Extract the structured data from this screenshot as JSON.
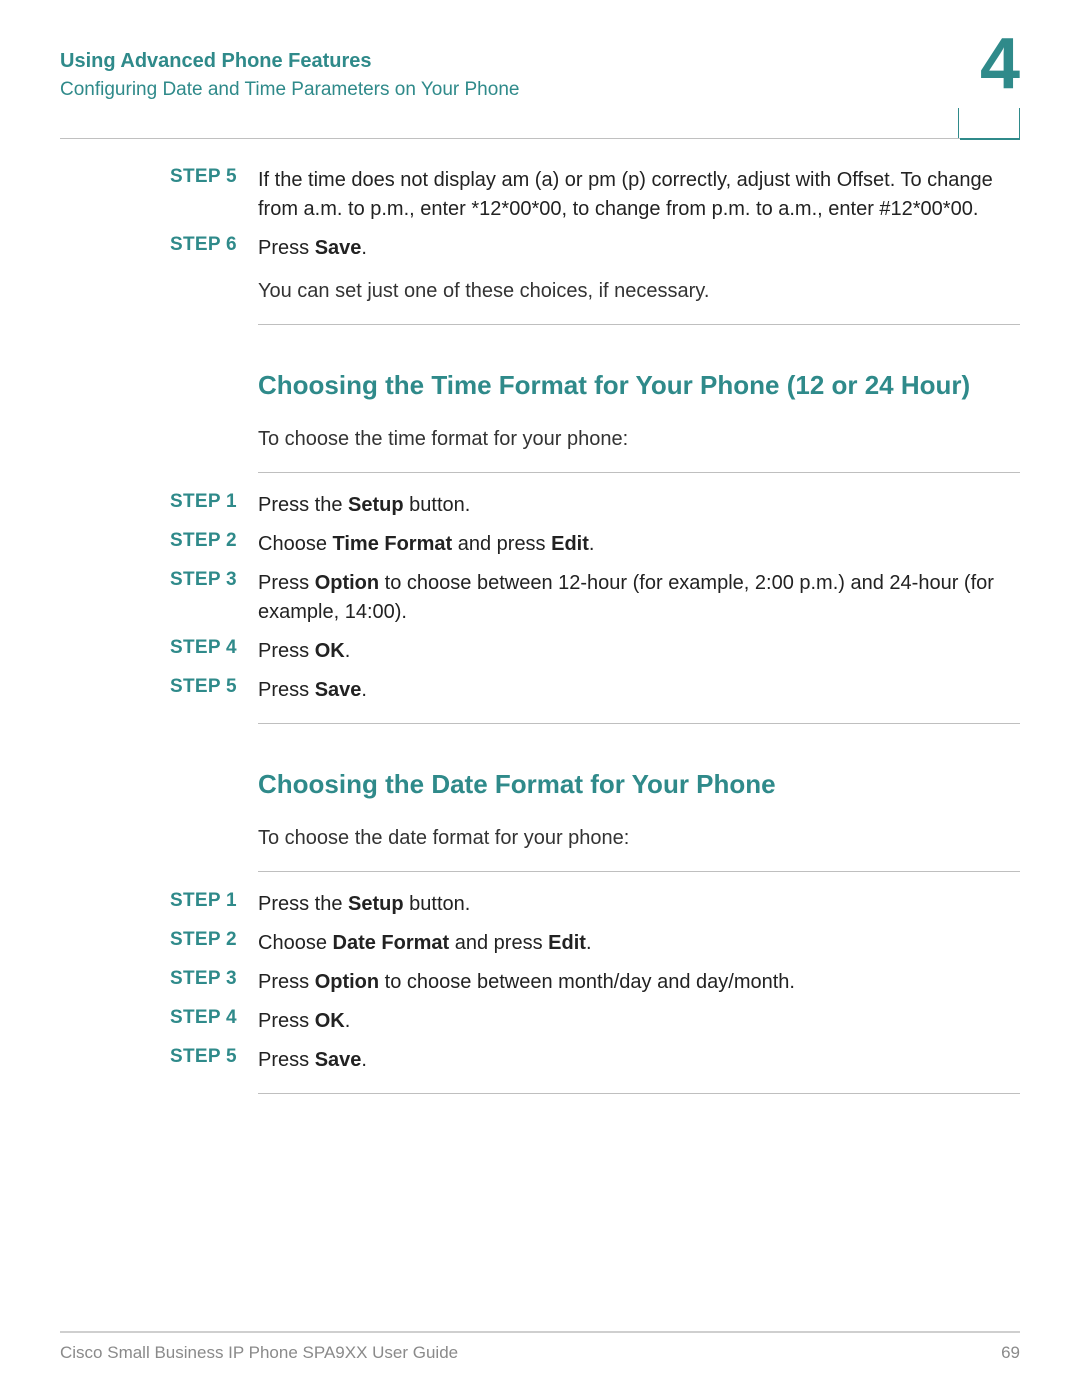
{
  "header": {
    "title": "Using Advanced Phone Features",
    "subtitle": "Configuring Date and Time Parameters on Your Phone",
    "chapter_number": "4"
  },
  "top_steps": [
    {
      "label": "STEP 5",
      "html": "If the time does not display am (a) or pm (p) correctly, adjust with Offset. To change from a.m. to p.m., enter *12*00*00, to change from p.m. to a.m., enter #12*00*00."
    },
    {
      "label": "STEP 6",
      "html": "Press <b>Save</b>."
    }
  ],
  "top_note": "You can set just one of these choices, if necessary.",
  "section_time": {
    "title": "Choosing the Time Format for Your Phone (12 or 24 Hour)",
    "intro": "To choose the time format for your phone:",
    "steps": [
      {
        "label": "STEP 1",
        "html": "Press the <b>Setup</b> button."
      },
      {
        "label": "STEP 2",
        "html": "Choose <b>Time Format</b> and press <b>Edit</b>."
      },
      {
        "label": "STEP 3",
        "html": "Press <b>Option</b> to choose between 12-hour (for example, 2:00 p.m.) and 24-hour (for example, 14:00)."
      },
      {
        "label": "STEP 4",
        "html": "Press <b>OK</b>."
      },
      {
        "label": "STEP 5",
        "html": "Press <b>Save</b>."
      }
    ]
  },
  "section_date": {
    "title": "Choosing the Date Format for Your Phone",
    "intro": "To choose the date format for your phone:",
    "steps": [
      {
        "label": "STEP 1",
        "html": "Press the <b>Setup</b> button."
      },
      {
        "label": "STEP 2",
        "html": "Choose <b>Date Format</b> and press <b>Edit</b>."
      },
      {
        "label": "STEP 3",
        "html": "Press <b>Option</b> to choose between month/day and day/month."
      },
      {
        "label": "STEP 4",
        "html": "Press <b>OK</b>."
      },
      {
        "label": "STEP 5",
        "html": "Press <b>Save</b>."
      }
    ]
  },
  "footer": {
    "left": "Cisco Small Business IP Phone SPA9XX User Guide",
    "right": "69"
  }
}
